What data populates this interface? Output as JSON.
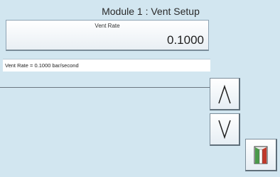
{
  "screen": {
    "title": "Module 1 : Vent Setup"
  },
  "field": {
    "label": "Vent Rate",
    "value": "0.1000"
  },
  "info": {
    "text": "Vent Rate = 0.1000 bar/second"
  },
  "buttons": {
    "up_icon": "chevron-up-icon",
    "down_icon": "chevron-down-icon",
    "exit_icon": "exit-door-icon"
  },
  "colors": {
    "background": "#d2e6f0",
    "door_green": "#4a9a4a",
    "door_red": "#c0392b"
  }
}
